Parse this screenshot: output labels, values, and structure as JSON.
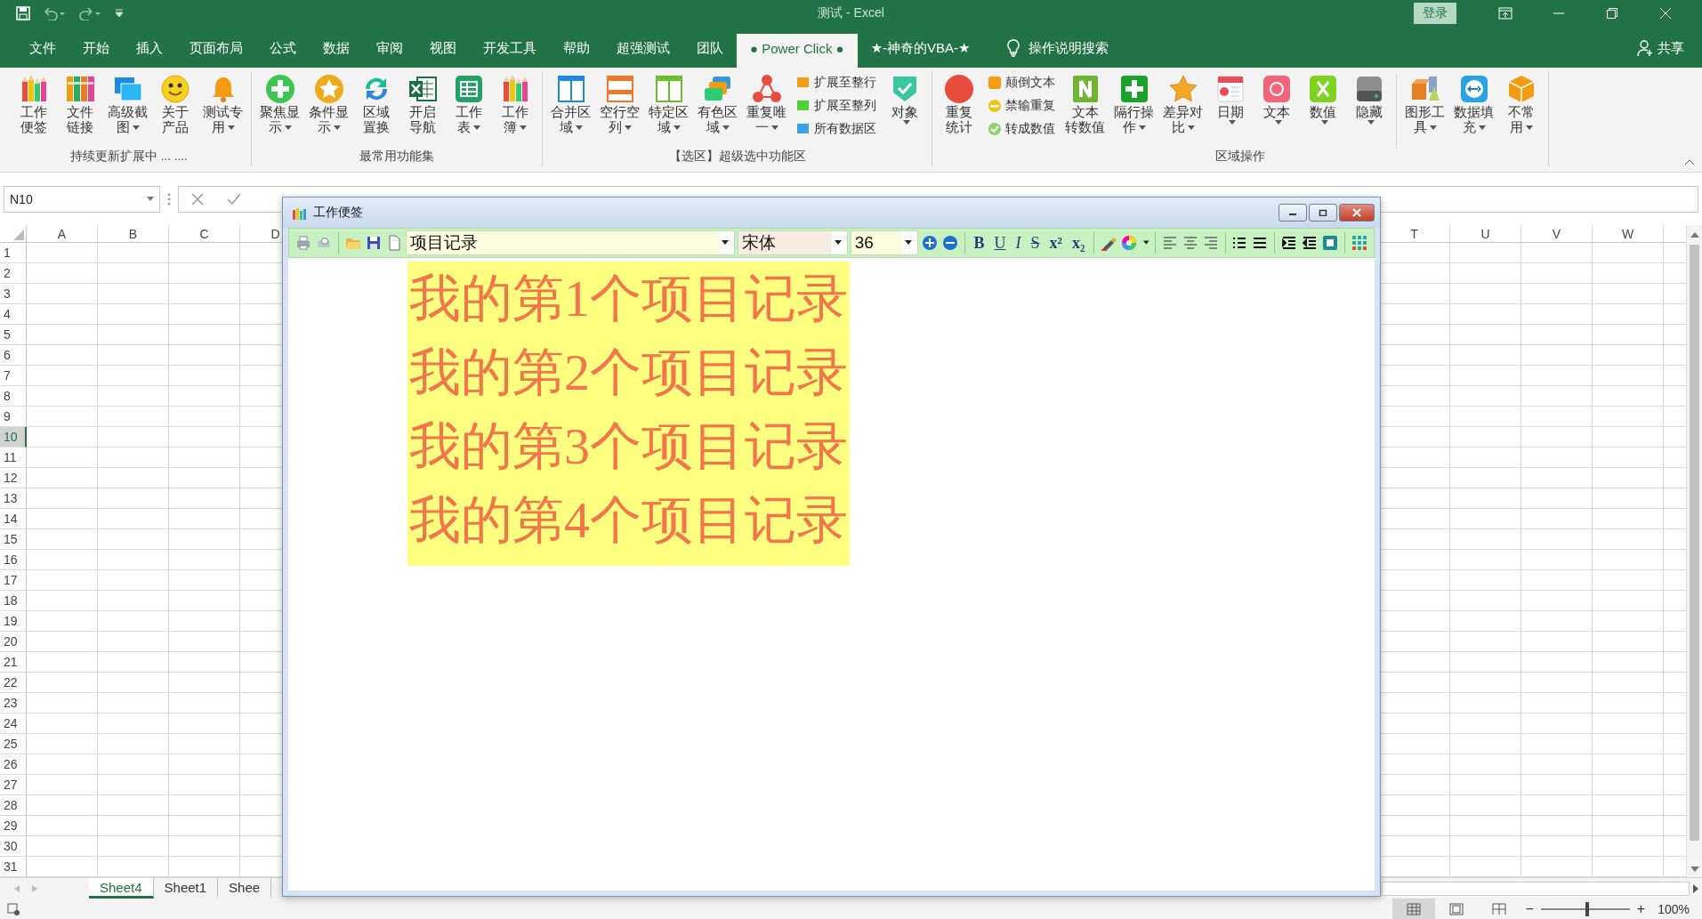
{
  "title_bar": {
    "title": "测试 - Excel",
    "sign_in": "登录"
  },
  "menu_tabs": [
    {
      "label": "文件",
      "selected": false
    },
    {
      "label": "开始",
      "selected": false
    },
    {
      "label": "插入",
      "selected": false
    },
    {
      "label": "页面布局",
      "selected": false
    },
    {
      "label": "公式",
      "selected": false
    },
    {
      "label": "数据",
      "selected": false
    },
    {
      "label": "审阅",
      "selected": false
    },
    {
      "label": "视图",
      "selected": false
    },
    {
      "label": "开发工具",
      "selected": false
    },
    {
      "label": "帮助",
      "selected": false
    },
    {
      "label": "超强测试",
      "selected": false
    },
    {
      "label": "团队",
      "selected": false
    },
    {
      "label": "● Power Click ●",
      "selected": true
    },
    {
      "label": "★-神奇的VBA-★",
      "selected": false
    }
  ],
  "search": {
    "label": "操作说明搜索"
  },
  "share": {
    "label": "共享"
  },
  "ribbon": {
    "groups": [
      {
        "title": "持续更新扩展中 ... ....",
        "items": [
          {
            "kind": "large",
            "lines": [
              "工作",
              "便签"
            ],
            "dropdown": false
          },
          {
            "kind": "large",
            "lines": [
              "文件",
              "链接"
            ],
            "dropdown": false
          },
          {
            "kind": "large",
            "lines": [
              "高级截",
              "图"
            ],
            "dropdown": true
          },
          {
            "kind": "large",
            "lines": [
              "关于",
              "产品"
            ],
            "dropdown": false
          },
          {
            "kind": "large",
            "lines": [
              "测试专",
              "用"
            ],
            "dropdown": true
          }
        ]
      },
      {
        "title": "最常用功能集",
        "items": [
          {
            "kind": "large",
            "lines": [
              "聚焦显",
              "示"
            ],
            "dropdown": true
          },
          {
            "kind": "large",
            "lines": [
              "条件显",
              "示"
            ],
            "dropdown": true
          },
          {
            "kind": "large",
            "lines": [
              "区域",
              "置换"
            ],
            "dropdown": false
          },
          {
            "kind": "large",
            "lines": [
              "开启",
              "导航"
            ],
            "dropdown": false
          },
          {
            "kind": "large",
            "lines": [
              "工作",
              "表"
            ],
            "dropdown": true
          },
          {
            "kind": "large",
            "lines": [
              "工作",
              "簿"
            ],
            "dropdown": true
          }
        ]
      },
      {
        "title": "【选区】超级选中功能区",
        "items": [
          {
            "kind": "large",
            "lines": [
              "合并区",
              "域"
            ],
            "dropdown": true
          },
          {
            "kind": "large",
            "lines": [
              "空行空",
              "列"
            ],
            "dropdown": true
          },
          {
            "kind": "large",
            "lines": [
              "特定区",
              "域"
            ],
            "dropdown": true
          },
          {
            "kind": "large",
            "lines": [
              "有色区",
              "域"
            ],
            "dropdown": true
          },
          {
            "kind": "large",
            "lines": [
              "重复唯",
              "一"
            ],
            "dropdown": true
          },
          {
            "kind": "stack",
            "buttons": [
              "扩展至整行",
              "扩展至整列",
              "所有数据区"
            ]
          },
          {
            "kind": "large",
            "lines": [
              "对象"
            ],
            "dropdown": true
          }
        ]
      },
      {
        "title": "区域操作",
        "items": [
          {
            "kind": "large",
            "lines": [
              "重复",
              "统计"
            ],
            "dropdown": false
          },
          {
            "kind": "stack",
            "buttons": [
              "颠倒文本",
              "禁输重复",
              "转成数值"
            ]
          },
          {
            "kind": "large",
            "lines": [
              "文本",
              "转数值"
            ],
            "dropdown": false
          },
          {
            "kind": "large",
            "lines": [
              "隔行操",
              "作"
            ],
            "dropdown": true
          },
          {
            "kind": "large",
            "lines": [
              "差异对",
              "比"
            ],
            "dropdown": true
          },
          {
            "kind": "large",
            "lines": [
              "日期"
            ],
            "dropdown": true
          },
          {
            "kind": "large",
            "lines": [
              "文本"
            ],
            "dropdown": true
          },
          {
            "kind": "large",
            "lines": [
              "数值"
            ],
            "dropdown": true
          },
          {
            "kind": "large",
            "lines": [
              "隐藏"
            ],
            "dropdown": true
          },
          {
            "kind": "separator"
          },
          {
            "kind": "large",
            "lines": [
              "图形工",
              "具"
            ],
            "dropdown": true
          },
          {
            "kind": "large",
            "lines": [
              "数据填",
              "充"
            ],
            "dropdown": true
          },
          {
            "kind": "large",
            "lines": [
              "不常",
              "用"
            ],
            "dropdown": true
          }
        ]
      }
    ]
  },
  "formula_bar": {
    "name_box": "N10"
  },
  "sheet": {
    "columns_left": [
      "A",
      "B",
      "C",
      "D"
    ],
    "columns_right": [
      "T",
      "U",
      "V",
      "W"
    ],
    "rows": [
      {
        "label": "1",
        "selected": false
      },
      {
        "label": "2",
        "selected": false
      },
      {
        "label": "3",
        "selected": false
      },
      {
        "label": "4",
        "selected": false
      },
      {
        "label": "5",
        "selected": false
      },
      {
        "label": "6",
        "selected": false
      },
      {
        "label": "7",
        "selected": false
      },
      {
        "label": "8",
        "selected": false
      },
      {
        "label": "9",
        "selected": false
      },
      {
        "label": "10",
        "selected": true
      },
      {
        "label": "11",
        "selected": false
      },
      {
        "label": "12",
        "selected": false
      },
      {
        "label": "13",
        "selected": false
      },
      {
        "label": "14",
        "selected": false
      },
      {
        "label": "15",
        "selected": false
      },
      {
        "label": "16",
        "selected": false
      },
      {
        "label": "17",
        "selected": false
      },
      {
        "label": "18",
        "selected": false
      },
      {
        "label": "19",
        "selected": false
      },
      {
        "label": "20",
        "selected": false
      },
      {
        "label": "21",
        "selected": false
      },
      {
        "label": "22",
        "selected": false
      },
      {
        "label": "23",
        "selected": false
      },
      {
        "label": "24",
        "selected": false
      },
      {
        "label": "25",
        "selected": false
      },
      {
        "label": "26",
        "selected": false
      },
      {
        "label": "27",
        "selected": false
      },
      {
        "label": "28",
        "selected": false
      },
      {
        "label": "29",
        "selected": false
      },
      {
        "label": "30",
        "selected": false
      },
      {
        "label": "31",
        "selected": false
      }
    ]
  },
  "sheet_tabs": [
    {
      "label": "Sheet4",
      "selected": true
    },
    {
      "label": "Sheet1",
      "selected": false
    },
    {
      "label": "Shee",
      "selected": false
    }
  ],
  "dialog": {
    "title": "工作便签",
    "toolbar": {
      "document": "项目记录",
      "font": "宋体",
      "size": "36",
      "format_buttons": [
        "B",
        "U",
        "I",
        "S",
        "x²",
        "x₂"
      ]
    },
    "lines": [
      "我的第1个项目记录",
      "我的第2个项目记录",
      "我的第3个项目记录",
      "我的第4个项目记录"
    ]
  },
  "status_bar": {
    "views": [
      {
        "selected": true
      },
      {
        "selected": false
      },
      {
        "selected": false
      }
    ],
    "zoom_out": "−",
    "zoom_in": "+",
    "zoom": {
      "level": 0.5,
      "reading": "100%"
    }
  }
}
